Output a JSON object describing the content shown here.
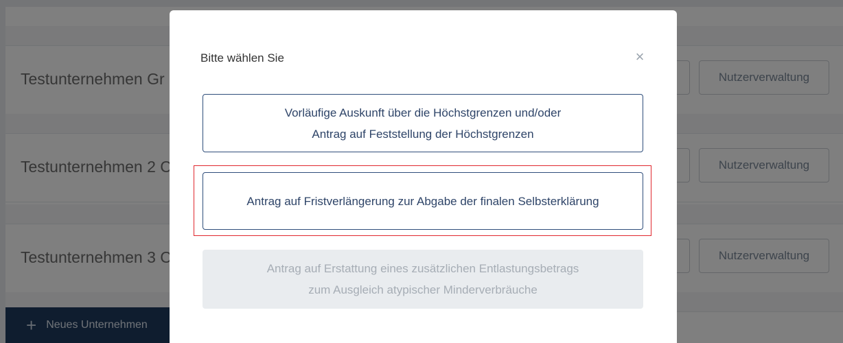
{
  "companies": [
    {
      "name": "Testunternehmen Gr",
      "users_button": "Nutzerverwaltung"
    },
    {
      "name": "Testunternehmen 2 C",
      "users_button": "Nutzerverwaltung"
    },
    {
      "name": "Testunternehmen 3 C",
      "users_button": "Nutzerverwaltung"
    }
  ],
  "new_company_button": "Neues Unternehmen",
  "modal": {
    "title": "Bitte wählen Sie",
    "close_symbol": "×",
    "options": [
      {
        "line1": "Vorläufige Auskunft über die Höchstgrenzen und/oder",
        "line2": "Antrag auf Feststellung der Höchstgrenzen",
        "enabled": true
      },
      {
        "line1": "Antrag auf Fristverlängerung zur Abgabe der finalen Selbsterklärung",
        "enabled": true,
        "highlighted": true
      },
      {
        "line1": "Antrag auf Erstattung eines zusätzlichen Entlastungsbetrags",
        "line2": "zum Ausgleich atypischer Minderverbräuche",
        "enabled": false
      }
    ]
  },
  "colors": {
    "primary": "#2e4d7a",
    "highlight": "#e0262c",
    "disabled_bg": "#e9ecef",
    "sidebar_button": "#1e3a5f"
  }
}
